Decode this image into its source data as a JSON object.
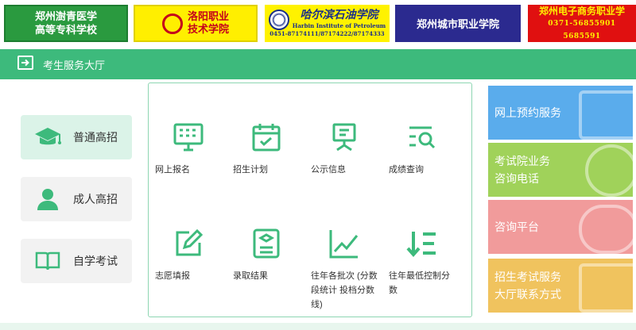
{
  "banners": {
    "b1": {
      "line1": "郑州澍青医学",
      "line2": "高等专科学校"
    },
    "b2": {
      "line1": "洛阳职业",
      "line2": "技术学院"
    },
    "b3": {
      "name": "哈尔滨石油学院",
      "en": "Harbin Institute of Petroleum",
      "phone": "0451-87174111/87174222/87174333"
    },
    "b4": {
      "name": "郑州城市职业学院"
    },
    "b5": {
      "name": "郑州电子商务职业学",
      "phone": "0371-56855901  5685591"
    }
  },
  "header": {
    "title": "考生服务大厅"
  },
  "sidebar": {
    "items": [
      {
        "label": "普通高招"
      },
      {
        "label": "成人高招"
      },
      {
        "label": "自学考试"
      }
    ]
  },
  "grid": {
    "items": [
      {
        "label": "网上报名"
      },
      {
        "label": "招生计划"
      },
      {
        "label": "公示信息"
      },
      {
        "label": "成绩查询"
      },
      {
        "label": "志愿填报"
      },
      {
        "label": "录取结果"
      },
      {
        "label": "往年各批次 (分数段统计 投档分数线)"
      },
      {
        "label": "往年最低控制分数"
      }
    ]
  },
  "cards": [
    {
      "line1": "网上预约服务",
      "line2": ""
    },
    {
      "line1": "考试院业务",
      "line2": "咨询电话"
    },
    {
      "line1": "咨询平台",
      "line2": ""
    },
    {
      "line1": "招生考试服务",
      "line2": "大厅联系方式"
    }
  ],
  "colors": {
    "accent": "#3dba7c",
    "icon": "#3dba7c"
  }
}
